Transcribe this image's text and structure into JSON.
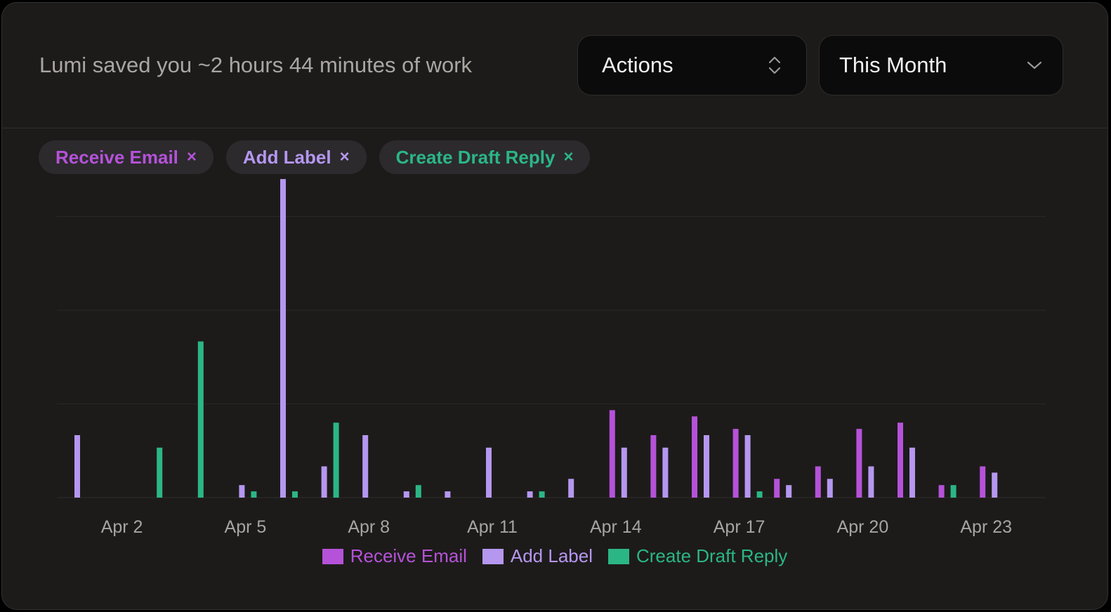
{
  "header": {
    "summary": "Lumi saved you ~2 hours 44 minutes of work",
    "actions_select": {
      "label": "Actions",
      "icon": "chevron-up-down-icon"
    },
    "period_select": {
      "label": "This Month",
      "icon": "chevron-down-icon"
    }
  },
  "filters": [
    {
      "label": "Receive Email",
      "remove": "×",
      "color": "#b552d9"
    },
    {
      "label": "Add Label",
      "remove": "×",
      "color": "#b597f0"
    },
    {
      "label": "Create Draft Reply",
      "remove": "×",
      "color": "#2bb686"
    }
  ],
  "chart_data": {
    "type": "bar",
    "grid": true,
    "ylim": [
      0,
      10
    ],
    "x_ticks": [
      "Apr 2",
      "Apr 5",
      "Apr 8",
      "Apr 11",
      "Apr 14",
      "Apr 17",
      "Apr 20",
      "Apr 23"
    ],
    "x": [
      "Apr 1",
      "Apr 2",
      "Apr 3",
      "Apr 4",
      "Apr 5",
      "Apr 6",
      "Apr 7",
      "Apr 8",
      "Apr 9",
      "Apr 10",
      "Apr 11",
      "Apr 12",
      "Apr 13",
      "Apr 14",
      "Apr 15",
      "Apr 16",
      "Apr 17",
      "Apr 18",
      "Apr 19",
      "Apr 20",
      "Apr 21",
      "Apr 22",
      "Apr 23"
    ],
    "series": [
      {
        "name": "Receive Email",
        "color": "#b552d9",
        "values": [
          0,
          0,
          0,
          0,
          0,
          0,
          0,
          0,
          0,
          0,
          0,
          0,
          0,
          2.8,
          2.0,
          2.6,
          2.2,
          0.6,
          1.0,
          2.2,
          2.4,
          0.4,
          1.0
        ]
      },
      {
        "name": "Add Label",
        "color": "#b597f0",
        "values": [
          2.0,
          0,
          0,
          0,
          0.4,
          10.2,
          1.0,
          2.0,
          0.2,
          0.2,
          1.6,
          0.2,
          0.6,
          1.6,
          1.6,
          2.0,
          2.0,
          0.4,
          0.6,
          1.0,
          1.6,
          0,
          0.8
        ]
      },
      {
        "name": "Create Draft Reply",
        "color": "#2bb686",
        "values": [
          0,
          0,
          1.6,
          5.0,
          0.2,
          0.2,
          2.4,
          0,
          0.4,
          0,
          0,
          0.2,
          0,
          0,
          0,
          0,
          0.2,
          0,
          0,
          0,
          0,
          0.4,
          0
        ]
      }
    ],
    "legend": "bottom-center"
  }
}
